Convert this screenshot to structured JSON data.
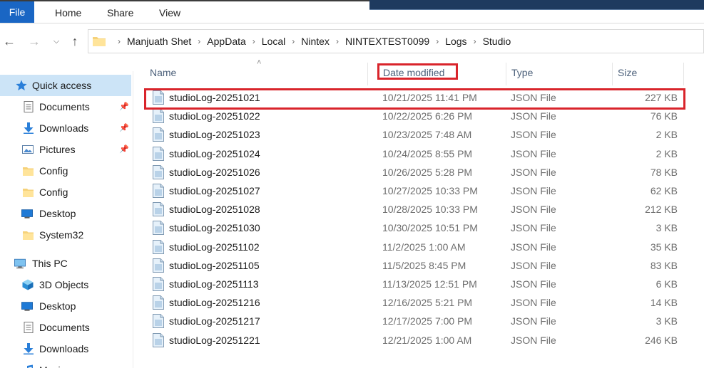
{
  "ribbon": {
    "tabs": [
      {
        "label": "File"
      },
      {
        "label": "Home"
      },
      {
        "label": "Share"
      },
      {
        "label": "View"
      }
    ]
  },
  "address": {
    "crumbs": [
      "Manjuath Shet",
      "AppData",
      "Local",
      "Nintex",
      "NINTEXTEST0099",
      "Logs",
      "Studio"
    ]
  },
  "sidebar": {
    "items": [
      {
        "label": "Quick access",
        "icon": "star-icon",
        "pinned": false
      },
      {
        "label": "Documents",
        "icon": "document-icon",
        "pinned": true
      },
      {
        "label": "Downloads",
        "icon": "download-icon",
        "pinned": true
      },
      {
        "label": "Pictures",
        "icon": "pictures-icon",
        "pinned": true
      },
      {
        "label": "Config",
        "icon": "folder-icon",
        "pinned": false
      },
      {
        "label": "Config",
        "icon": "folder-icon",
        "pinned": false
      },
      {
        "label": "Desktop",
        "icon": "desktop-icon",
        "pinned": false
      },
      {
        "label": "System32",
        "icon": "folder-icon",
        "pinned": false
      },
      {
        "label": "This PC",
        "icon": "computer-icon",
        "pinned": false
      },
      {
        "label": "3D Objects",
        "icon": "3d-objects-icon",
        "pinned": false
      },
      {
        "label": "Desktop",
        "icon": "desktop-icon",
        "pinned": false
      },
      {
        "label": "Documents",
        "icon": "document-icon",
        "pinned": false
      },
      {
        "label": "Downloads",
        "icon": "download-icon",
        "pinned": false
      },
      {
        "label": "Music",
        "icon": "music-icon",
        "pinned": false
      }
    ]
  },
  "columns": {
    "name": "Name",
    "date": "Date modified",
    "type": "Type",
    "size": "Size"
  },
  "files": [
    {
      "name": "studioLog-20251021",
      "date": "10/21/2025 11:41 PM",
      "type": "JSON File",
      "size": "227 KB"
    },
    {
      "name": "studioLog-20251022",
      "date": "10/22/2025 6:26 PM",
      "type": "JSON File",
      "size": "76 KB"
    },
    {
      "name": "studioLog-20251023",
      "date": "10/23/2025 7:48 AM",
      "type": "JSON File",
      "size": "2 KB"
    },
    {
      "name": "studioLog-20251024",
      "date": "10/24/2025 8:55 PM",
      "type": "JSON File",
      "size": "2 KB"
    },
    {
      "name": "studioLog-20251026",
      "date": "10/26/2025 5:28 PM",
      "type": "JSON File",
      "size": "78 KB"
    },
    {
      "name": "studioLog-20251027",
      "date": "10/27/2025 10:33 PM",
      "type": "JSON File",
      "size": "62 KB"
    },
    {
      "name": "studioLog-20251028",
      "date": "10/28/2025 10:33 PM",
      "type": "JSON File",
      "size": "212 KB"
    },
    {
      "name": "studioLog-20251030",
      "date": "10/30/2025 10:51 PM",
      "type": "JSON File",
      "size": "3 KB"
    },
    {
      "name": "studioLog-20251102",
      "date": "11/2/2025 1:00 AM",
      "type": "JSON File",
      "size": "35 KB"
    },
    {
      "name": "studioLog-20251105",
      "date": "11/5/2025 8:45 PM",
      "type": "JSON File",
      "size": "83 KB"
    },
    {
      "name": "studioLog-20251113",
      "date": "11/13/2025 12:51 PM",
      "type": "JSON File",
      "size": "6 KB"
    },
    {
      "name": "studioLog-20251216",
      "date": "12/16/2025 5:21 PM",
      "type": "JSON File",
      "size": "14 KB"
    },
    {
      "name": "studioLog-20251217",
      "date": "12/17/2025 7:00 PM",
      "type": "JSON File",
      "size": "3 KB"
    },
    {
      "name": "studioLog-20251221",
      "date": "12/21/2025 1:00 AM",
      "type": "JSON File",
      "size": "246 KB"
    }
  ],
  "colors": {
    "accent": "#1a66c4",
    "selection": "#cce4f7",
    "highlight": "#d9242b"
  }
}
